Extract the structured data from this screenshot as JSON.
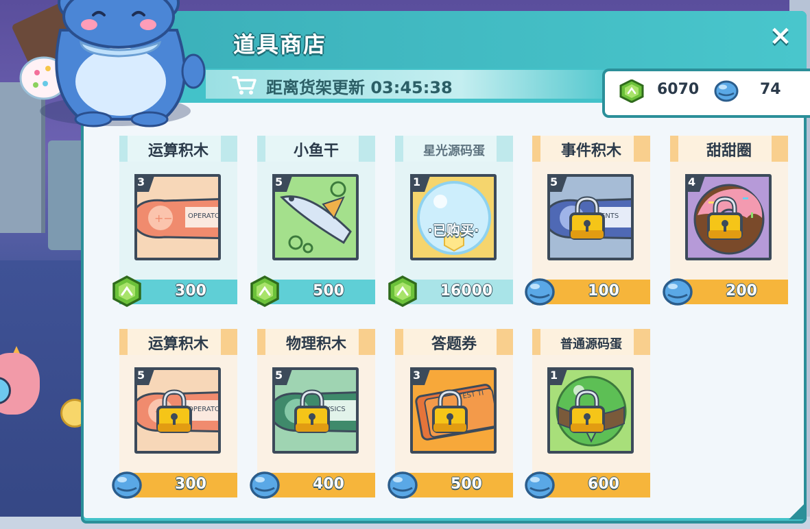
{
  "shop": {
    "title": "道具商店",
    "refresh_label": "距离货架更新 03:45:38",
    "close_icon": "×"
  },
  "currency": {
    "gems": "6070",
    "bells": "74"
  },
  "colors": {
    "panel": "#43c2c9",
    "teal_price": "#5fcfd6",
    "orange_price": "#f6b53b",
    "gem_green": "#6cc23a",
    "bell_blue": "#5aa8e6"
  },
  "items": [
    {
      "name": "运算积木",
      "level": "3",
      "price": "300",
      "currency": "gem-icon",
      "locked": false,
      "sold": false,
      "theme": "teal",
      "art": "operator-block"
    },
    {
      "name": "小鱼干",
      "level": "5",
      "price": "500",
      "currency": "gem-icon",
      "locked": false,
      "sold": false,
      "theme": "teal",
      "art": "dried-fish"
    },
    {
      "name": "星光源码蛋",
      "level": "1",
      "price": "16000",
      "currency": "gem-icon",
      "locked": false,
      "sold": true,
      "sold_label": "·已购买·",
      "theme": "teal",
      "art": "star-egg"
    },
    {
      "name": "事件积木",
      "level": "5",
      "price": "100",
      "currency": "bell-icon",
      "locked": true,
      "sold": false,
      "theme": "orange",
      "art": "event-block"
    },
    {
      "name": "甜甜圈",
      "level": "4",
      "price": "200",
      "currency": "bell-icon",
      "locked": true,
      "sold": false,
      "theme": "orange",
      "art": "donut"
    },
    {
      "name": "运算积木",
      "level": "5",
      "price": "300",
      "currency": "bell-icon",
      "locked": true,
      "sold": false,
      "theme": "orange",
      "art": "operator-block"
    },
    {
      "name": "物理积木",
      "level": "5",
      "price": "400",
      "currency": "bell-icon",
      "locked": true,
      "sold": false,
      "theme": "orange",
      "art": "physics-block"
    },
    {
      "name": "答题券",
      "level": "3",
      "price": "500",
      "currency": "bell-icon",
      "locked": true,
      "sold": false,
      "theme": "orange",
      "art": "quiz-ticket"
    },
    {
      "name": "普通源码蛋",
      "level": "1",
      "price": "600",
      "currency": "bell-icon",
      "locked": true,
      "sold": false,
      "theme": "orange",
      "art": "normal-egg"
    }
  ]
}
